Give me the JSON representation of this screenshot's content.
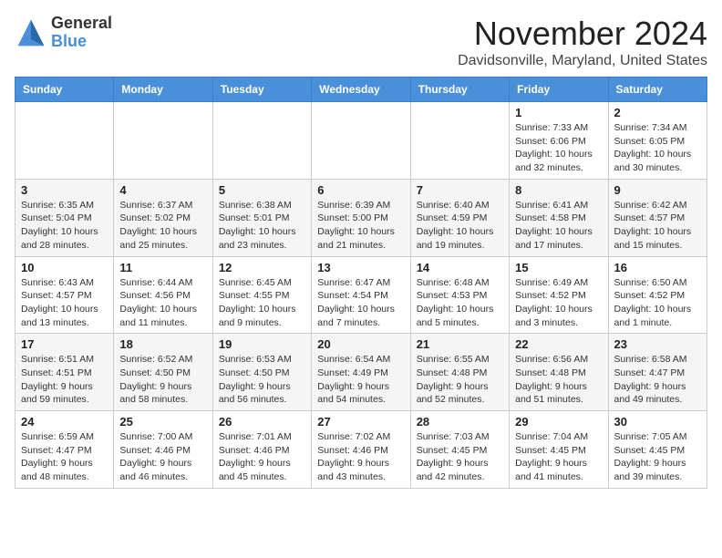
{
  "header": {
    "logo_general": "General",
    "logo_blue": "Blue",
    "month_title": "November 2024",
    "location": "Davidsonville, Maryland, United States"
  },
  "days_of_week": [
    "Sunday",
    "Monday",
    "Tuesday",
    "Wednesday",
    "Thursday",
    "Friday",
    "Saturday"
  ],
  "weeks": [
    [
      {
        "day": "",
        "info": ""
      },
      {
        "day": "",
        "info": ""
      },
      {
        "day": "",
        "info": ""
      },
      {
        "day": "",
        "info": ""
      },
      {
        "day": "",
        "info": ""
      },
      {
        "day": "1",
        "info": "Sunrise: 7:33 AM\nSunset: 6:06 PM\nDaylight: 10 hours and 32 minutes."
      },
      {
        "day": "2",
        "info": "Sunrise: 7:34 AM\nSunset: 6:05 PM\nDaylight: 10 hours and 30 minutes."
      }
    ],
    [
      {
        "day": "3",
        "info": "Sunrise: 6:35 AM\nSunset: 5:04 PM\nDaylight: 10 hours and 28 minutes."
      },
      {
        "day": "4",
        "info": "Sunrise: 6:37 AM\nSunset: 5:02 PM\nDaylight: 10 hours and 25 minutes."
      },
      {
        "day": "5",
        "info": "Sunrise: 6:38 AM\nSunset: 5:01 PM\nDaylight: 10 hours and 23 minutes."
      },
      {
        "day": "6",
        "info": "Sunrise: 6:39 AM\nSunset: 5:00 PM\nDaylight: 10 hours and 21 minutes."
      },
      {
        "day": "7",
        "info": "Sunrise: 6:40 AM\nSunset: 4:59 PM\nDaylight: 10 hours and 19 minutes."
      },
      {
        "day": "8",
        "info": "Sunrise: 6:41 AM\nSunset: 4:58 PM\nDaylight: 10 hours and 17 minutes."
      },
      {
        "day": "9",
        "info": "Sunrise: 6:42 AM\nSunset: 4:57 PM\nDaylight: 10 hours and 15 minutes."
      }
    ],
    [
      {
        "day": "10",
        "info": "Sunrise: 6:43 AM\nSunset: 4:57 PM\nDaylight: 10 hours and 13 minutes."
      },
      {
        "day": "11",
        "info": "Sunrise: 6:44 AM\nSunset: 4:56 PM\nDaylight: 10 hours and 11 minutes."
      },
      {
        "day": "12",
        "info": "Sunrise: 6:45 AM\nSunset: 4:55 PM\nDaylight: 10 hours and 9 minutes."
      },
      {
        "day": "13",
        "info": "Sunrise: 6:47 AM\nSunset: 4:54 PM\nDaylight: 10 hours and 7 minutes."
      },
      {
        "day": "14",
        "info": "Sunrise: 6:48 AM\nSunset: 4:53 PM\nDaylight: 10 hours and 5 minutes."
      },
      {
        "day": "15",
        "info": "Sunrise: 6:49 AM\nSunset: 4:52 PM\nDaylight: 10 hours and 3 minutes."
      },
      {
        "day": "16",
        "info": "Sunrise: 6:50 AM\nSunset: 4:52 PM\nDaylight: 10 hours and 1 minute."
      }
    ],
    [
      {
        "day": "17",
        "info": "Sunrise: 6:51 AM\nSunset: 4:51 PM\nDaylight: 9 hours and 59 minutes."
      },
      {
        "day": "18",
        "info": "Sunrise: 6:52 AM\nSunset: 4:50 PM\nDaylight: 9 hours and 58 minutes."
      },
      {
        "day": "19",
        "info": "Sunrise: 6:53 AM\nSunset: 4:50 PM\nDaylight: 9 hours and 56 minutes."
      },
      {
        "day": "20",
        "info": "Sunrise: 6:54 AM\nSunset: 4:49 PM\nDaylight: 9 hours and 54 minutes."
      },
      {
        "day": "21",
        "info": "Sunrise: 6:55 AM\nSunset: 4:48 PM\nDaylight: 9 hours and 52 minutes."
      },
      {
        "day": "22",
        "info": "Sunrise: 6:56 AM\nSunset: 4:48 PM\nDaylight: 9 hours and 51 minutes."
      },
      {
        "day": "23",
        "info": "Sunrise: 6:58 AM\nSunset: 4:47 PM\nDaylight: 9 hours and 49 minutes."
      }
    ],
    [
      {
        "day": "24",
        "info": "Sunrise: 6:59 AM\nSunset: 4:47 PM\nDaylight: 9 hours and 48 minutes."
      },
      {
        "day": "25",
        "info": "Sunrise: 7:00 AM\nSunset: 4:46 PM\nDaylight: 9 hours and 46 minutes."
      },
      {
        "day": "26",
        "info": "Sunrise: 7:01 AM\nSunset: 4:46 PM\nDaylight: 9 hours and 45 minutes."
      },
      {
        "day": "27",
        "info": "Sunrise: 7:02 AM\nSunset: 4:46 PM\nDaylight: 9 hours and 43 minutes."
      },
      {
        "day": "28",
        "info": "Sunrise: 7:03 AM\nSunset: 4:45 PM\nDaylight: 9 hours and 42 minutes."
      },
      {
        "day": "29",
        "info": "Sunrise: 7:04 AM\nSunset: 4:45 PM\nDaylight: 9 hours and 41 minutes."
      },
      {
        "day": "30",
        "info": "Sunrise: 7:05 AM\nSunset: 4:45 PM\nDaylight: 9 hours and 39 minutes."
      }
    ]
  ],
  "colors": {
    "header_bg": "#4a90d9",
    "header_text": "#ffffff",
    "row_even": "#f5f5f5",
    "row_odd": "#ffffff"
  }
}
